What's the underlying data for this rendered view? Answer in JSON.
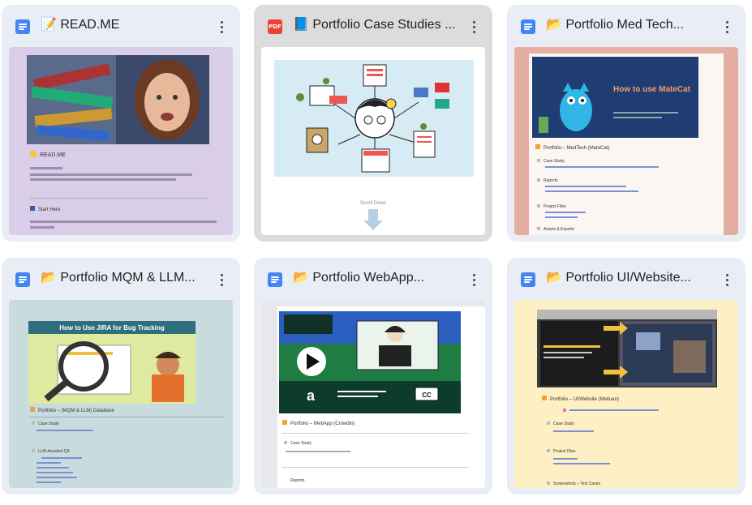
{
  "cards": [
    {
      "title": "📝 READ.ME",
      "type_icon": "doc-icon",
      "emoji_icon": "pencil-note-icon",
      "thumb": {
        "heading": "READ.ME",
        "section": "Start Here",
        "bg": "#d9cde8"
      }
    },
    {
      "title": "📘 Portfolio Case Studies ...",
      "type_icon": "pdf-icon",
      "type_label": "PDF",
      "emoji_icon": "blue-book-icon",
      "thumb": {
        "caption": "Scroll Down",
        "bg": "#ffffff"
      }
    },
    {
      "title": "📂 Portfolio Med Tech...",
      "type_icon": "doc-icon",
      "emoji_icon": "folder-icon",
      "thumb": {
        "banner_title": "How to use MateCat",
        "heading": "Portfolio – MedTech (MateCat)",
        "items": [
          "Case Study",
          "Reports",
          "Project Files",
          "Assets & Exports"
        ],
        "bg": "#e4aea3"
      }
    },
    {
      "title": "📂 Portfolio MQM & LLM...",
      "type_icon": "doc-icon",
      "emoji_icon": "folder-icon",
      "thumb": {
        "banner_title": "How to Use JIRA for Bug Tracking",
        "heading": "Portfolio – (MQM & LLM) Database",
        "items": [
          "Case Study",
          "LLM-Assisted QA"
        ],
        "bg": "#c9dcdd"
      }
    },
    {
      "title": "📂 Portfolio WebApp...",
      "type_icon": "doc-icon",
      "emoji_icon": "folder-icon",
      "thumb": {
        "heading": "Portfolio – WebApp (Crowdin)",
        "items": [
          "Case Study",
          "Reports"
        ],
        "cc_label": "CC",
        "bg": "#e8e8ec"
      }
    },
    {
      "title": "📂 Portfolio UI/Website...",
      "type_icon": "doc-icon",
      "emoji_icon": "folder-icon",
      "thumb": {
        "heading": "Portfolio – UI/Website (Meituan)",
        "items": [
          "Case Study",
          "Project Files",
          "Screenshots – Test Cases"
        ],
        "bg": "#fdf0c4"
      }
    }
  ]
}
